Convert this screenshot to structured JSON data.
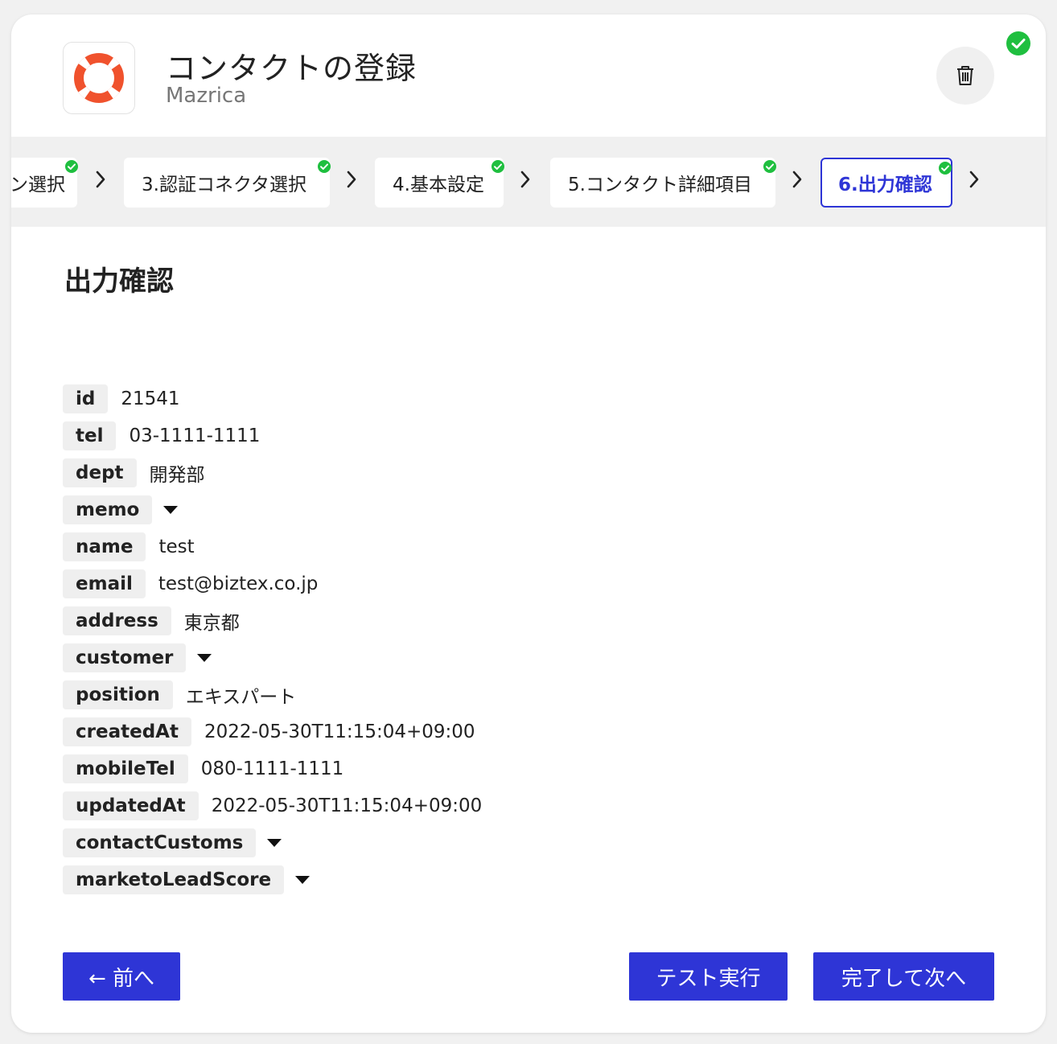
{
  "header": {
    "title": "コンタクトの登録",
    "subtitle": "Mazrica",
    "logo_icon": "lifebuoy-logo",
    "trash_icon": "trash-icon",
    "status_icon": "check-circle-icon"
  },
  "steps": [
    {
      "label": "ン選択",
      "done": true
    },
    {
      "label": "3.認証コネクタ選択",
      "done": true
    },
    {
      "label": "4.基本設定",
      "done": true
    },
    {
      "label": "5.コンタクト詳細項目",
      "done": true
    },
    {
      "label": "6.出力確認",
      "done": true,
      "active": true
    }
  ],
  "section": {
    "title": "出力確認"
  },
  "fields": [
    {
      "key": "id",
      "value": "21541"
    },
    {
      "key": "tel",
      "value": "03-1111-1111"
    },
    {
      "key": "dept",
      "value": "開発部"
    },
    {
      "key": "memo",
      "value": "",
      "expandable": true
    },
    {
      "key": "name",
      "value": "test"
    },
    {
      "key": "email",
      "value": "test@biztex.co.jp"
    },
    {
      "key": "address",
      "value": "東京都"
    },
    {
      "key": "customer",
      "value": "",
      "expandable": true
    },
    {
      "key": "position",
      "value": "エキスパート"
    },
    {
      "key": "createdAt",
      "value": "2022-05-30T11:15:04+09:00"
    },
    {
      "key": "mobileTel",
      "value": "080-1111-1111"
    },
    {
      "key": "updatedAt",
      "value": "2022-05-30T11:15:04+09:00"
    },
    {
      "key": "contactCustoms",
      "value": "",
      "expandable": true
    },
    {
      "key": "marketoLeadScore",
      "value": "",
      "expandable": true
    }
  ],
  "buttons": {
    "prev": "← 前へ",
    "test": "テスト実行",
    "next": "完了して次へ"
  },
  "colors": {
    "accent": "#2e35d6",
    "success": "#1fbf3f",
    "logo": "#f0522d"
  }
}
